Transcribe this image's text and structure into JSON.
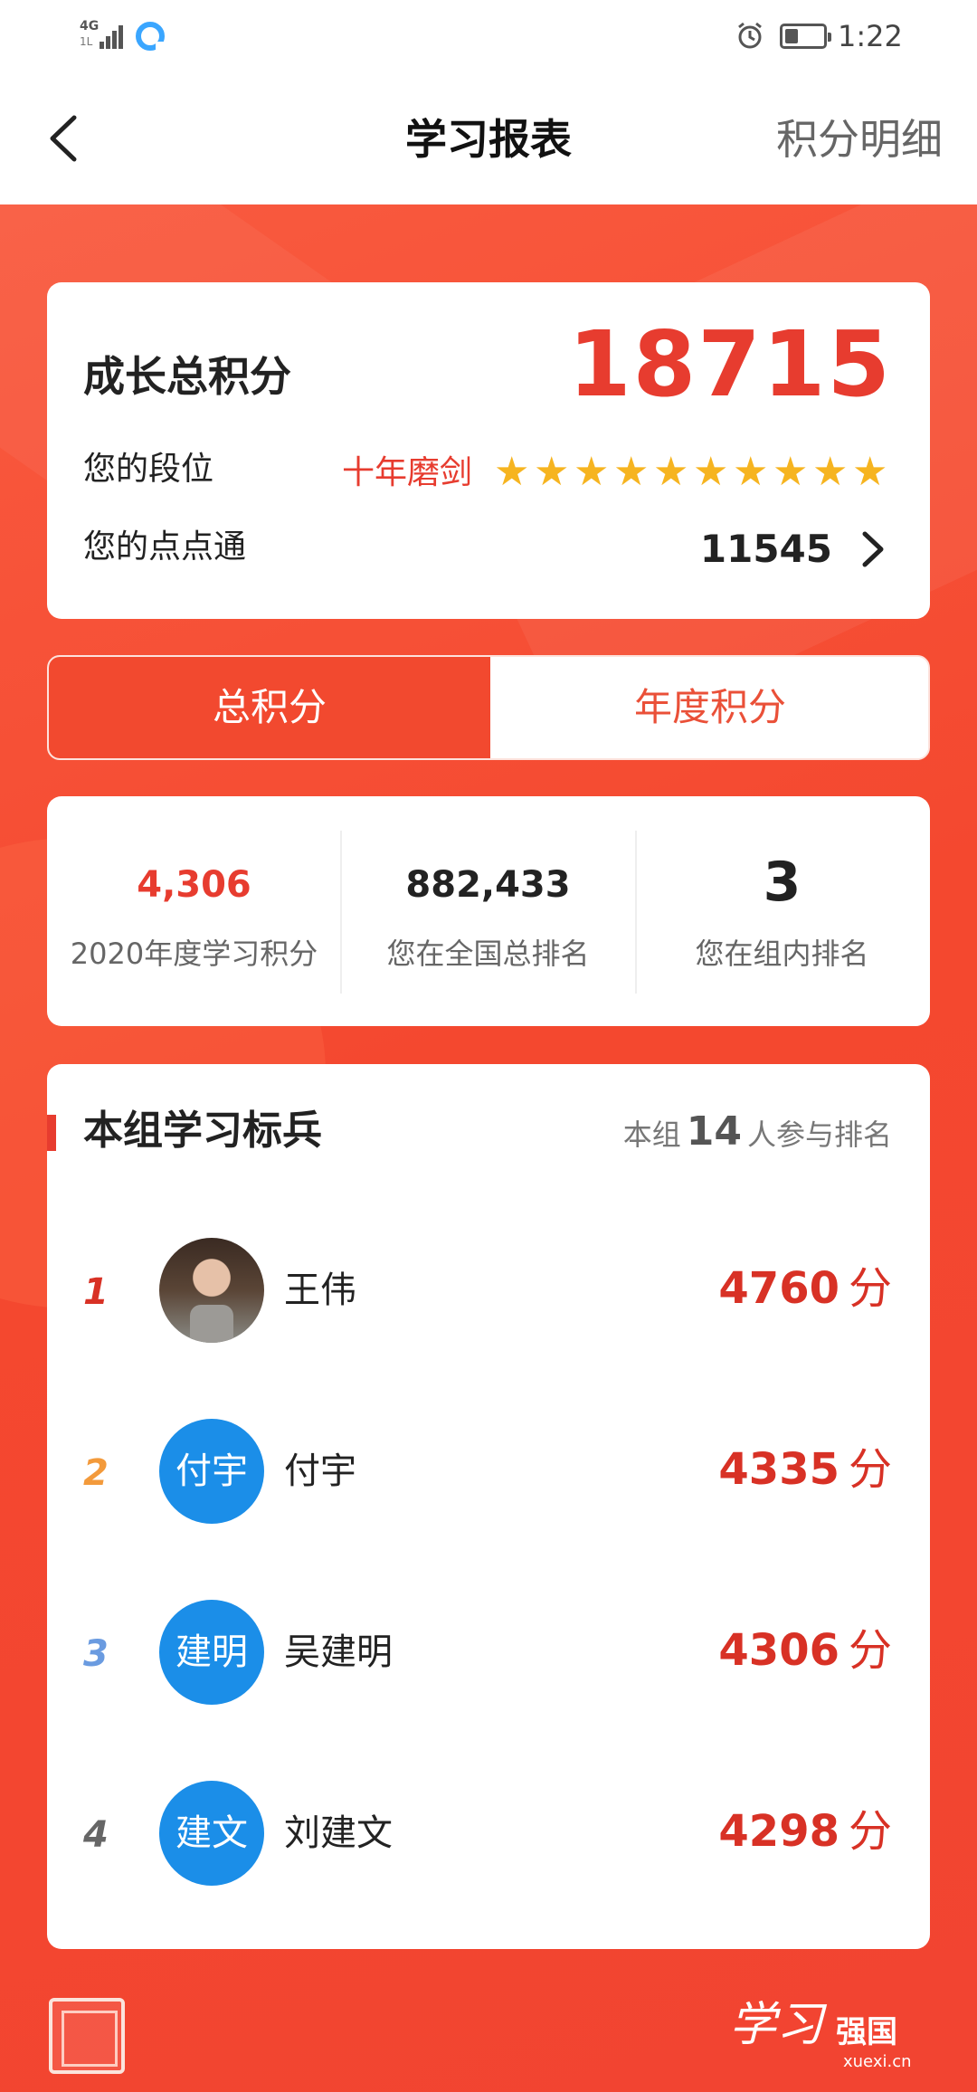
{
  "status_bar": {
    "network": "4G",
    "network_sub": "1L",
    "time": "1:22",
    "battery_percent": 35
  },
  "nav": {
    "title": "学习报表",
    "right_action": "积分明细"
  },
  "score_card": {
    "label": "成长总积分",
    "value": "18715",
    "rank_label": "您的段位",
    "rank_name": "十年磨剑",
    "stars": 10,
    "points_label": "您的点点通",
    "points_value": "11545"
  },
  "tabs": [
    {
      "label": "总积分",
      "active": true
    },
    {
      "label": "年度积分",
      "active": false
    }
  ],
  "stats": [
    {
      "value": "4,306",
      "label": "2020年度学习积分"
    },
    {
      "value": "882,433",
      "label": "您在全国总排名"
    },
    {
      "value": "3",
      "label": "您在组内排名"
    }
  ],
  "board": {
    "title": "本组学习标兵",
    "count_prefix": "本组",
    "count": "14",
    "count_suffix": "人参与排名",
    "rows": [
      {
        "rank": "1",
        "rank_color": "#d83125",
        "avatar_text": "",
        "name": "王伟",
        "points": "4760",
        "unit": "分"
      },
      {
        "rank": "2",
        "rank_color": "#f39a3b",
        "avatar_text": "付宇",
        "name": "付宇",
        "points": "4335",
        "unit": "分"
      },
      {
        "rank": "3",
        "rank_color": "#6a9be0",
        "avatar_text": "建明",
        "name": "吴建明",
        "points": "4306",
        "unit": "分"
      },
      {
        "rank": "4",
        "rank_color": "#666666",
        "avatar_text": "建文",
        "name": "刘建文",
        "points": "4298",
        "unit": "分"
      }
    ]
  },
  "footer": {
    "logo_script": "学习",
    "logo_brand": "强国",
    "logo_url": "xuexi.cn"
  }
}
